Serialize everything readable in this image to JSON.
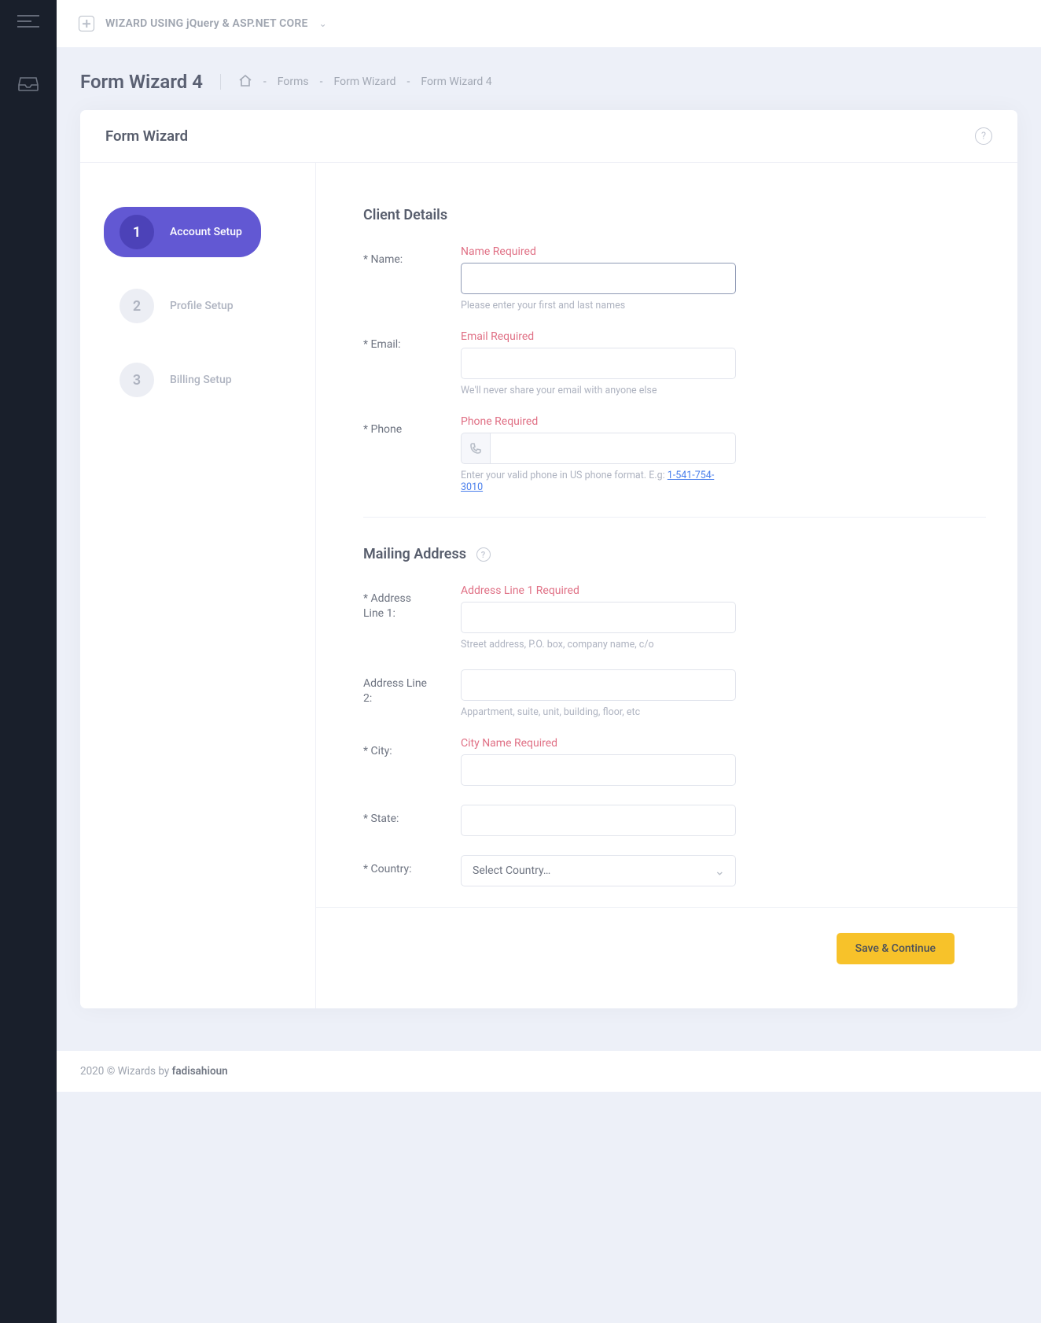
{
  "topbar": {
    "title": "WIZARD USING jQuery & ASP.NET CORE"
  },
  "page": {
    "title": "Form Wizard 4"
  },
  "breadcrumbs": [
    {
      "label": "Forms"
    },
    {
      "label": "Form Wizard"
    },
    {
      "label": "Form Wizard 4"
    }
  ],
  "card": {
    "title": "Form Wizard"
  },
  "steps": [
    {
      "num": "1",
      "label": "Account Setup",
      "active": true
    },
    {
      "num": "2",
      "label": "Profile Setup",
      "active": false
    },
    {
      "num": "3",
      "label": "Billing Setup",
      "active": false
    }
  ],
  "sections": {
    "client": {
      "title": "Client Details"
    },
    "mailing": {
      "title": "Mailing Address"
    }
  },
  "fields": {
    "name": {
      "label": "* Name:",
      "error": "Name Required",
      "help": "Please enter your first and last names",
      "value": ""
    },
    "email": {
      "label": "* Email:",
      "error": "Email Required",
      "help": "We'll never share your email with anyone else",
      "value": ""
    },
    "phone": {
      "label": "* Phone",
      "error": "Phone Required",
      "help_prefix": "Enter your valid phone in US phone format. E.g: ",
      "help_link": "1-541-754-3010",
      "value": ""
    },
    "addr1": {
      "label": "* Address Line 1:",
      "error": "Address Line 1 Required",
      "help": "Street address, P.O. box, company name, c/o",
      "value": ""
    },
    "addr2": {
      "label": "Address Line 2:",
      "help": "Appartment, suite, unit, building, floor, etc",
      "value": ""
    },
    "city": {
      "label": "* City:",
      "error": "City Name Required",
      "value": ""
    },
    "state": {
      "label": "* State:",
      "value": ""
    },
    "country": {
      "label": "* Country:",
      "selected": "Select Country…"
    }
  },
  "actions": {
    "save": "Save & Continue"
  },
  "footer": {
    "prefix": "2020 © Wizards by ",
    "author": "fadisahioun"
  }
}
